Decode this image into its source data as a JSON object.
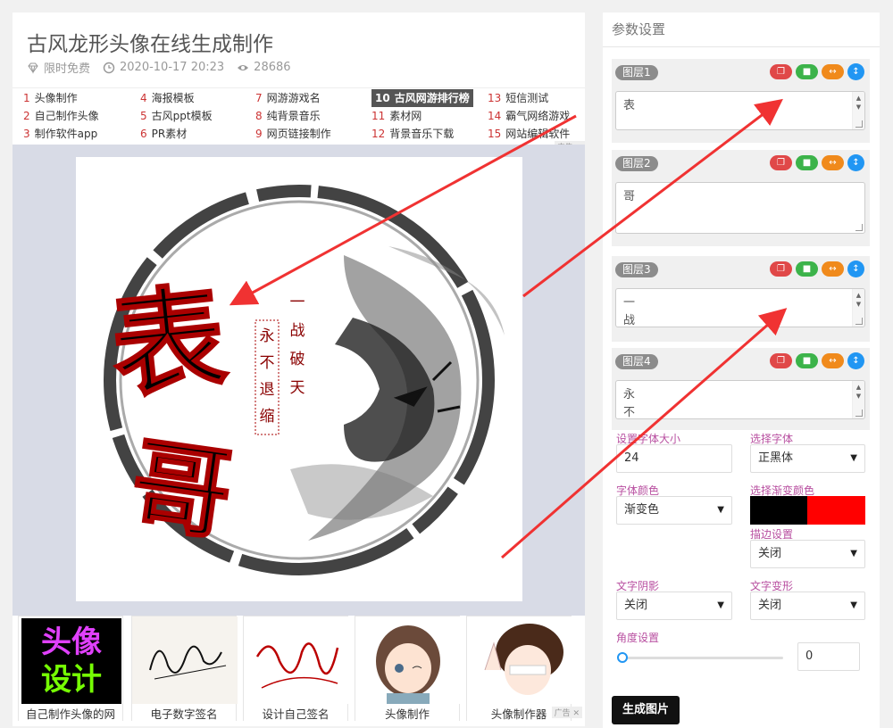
{
  "page": {
    "title": "古风龙形头像在线生成制作",
    "badge": "限时免费",
    "date": "2020-10-17 20:23",
    "views": "28686"
  },
  "links": [
    [
      {
        "n": "1",
        "t": "头像制作"
      },
      {
        "n": "4",
        "t": "海报模板"
      },
      {
        "n": "7",
        "t": "网游游戏名"
      },
      {
        "n": "10",
        "t": "古风网游排行榜"
      },
      {
        "n": "13",
        "t": "短信测试"
      }
    ],
    [
      {
        "n": "2",
        "t": "自己制作头像"
      },
      {
        "n": "5",
        "t": "古风ppt模板"
      },
      {
        "n": "8",
        "t": "纯背景音乐"
      },
      {
        "n": "11",
        "t": "素材网"
      },
      {
        "n": "14",
        "t": "霸气网络游戏"
      }
    ],
    [
      {
        "n": "3",
        "t": "制作软件app"
      },
      {
        "n": "6",
        "t": "PR素材"
      },
      {
        "n": "9",
        "t": "网页链接制作"
      },
      {
        "n": "12",
        "t": "背景音乐下载"
      },
      {
        "n": "15",
        "t": "网站编辑软件"
      }
    ]
  ],
  "poster": {
    "big_text_1": "表",
    "big_text_2": "哥",
    "vert_1": [
      "一",
      "战",
      "破",
      "天"
    ],
    "vert_2": [
      "永",
      "不",
      "退",
      "缩"
    ]
  },
  "thumbs": [
    {
      "label": "自己制作头像的网",
      "inner1": "头像",
      "inner2": "设计"
    },
    {
      "label": "电子数字签名"
    },
    {
      "label": "设计自己签名"
    },
    {
      "label": "头像制作"
    },
    {
      "label": "头像制作器"
    }
  ],
  "panel": {
    "title": "参数设置",
    "layers": [
      {
        "tag": "图层1",
        "lines": [
          "表"
        ]
      },
      {
        "tag": "图层2",
        "lines": [
          "哥"
        ]
      },
      {
        "tag": "图层3",
        "lines": [
          "一",
          "战"
        ]
      },
      {
        "tag": "图层4",
        "lines": [
          "永",
          "不"
        ]
      }
    ],
    "font_size_label": "设置字体大小",
    "font_size_value": "24",
    "font_label": "选择字体",
    "font_value": "正黑体",
    "color_label": "字体颜色",
    "color_value": "渐变色",
    "gradient_label": "选择渐变颜色",
    "gradient_colors": [
      "#000000",
      "#ff0000"
    ],
    "stroke_label": "描边设置",
    "stroke_value": "关闭",
    "shadow_label": "文字阴影",
    "shadow_value": "关闭",
    "transform_label": "文字变形",
    "transform_value": "关闭",
    "angle_label": "角度设置",
    "angle_value": "0",
    "angle_fraction": 0,
    "generate": "生成图片"
  },
  "ad_marks": [
    "广告",
    "✕"
  ]
}
